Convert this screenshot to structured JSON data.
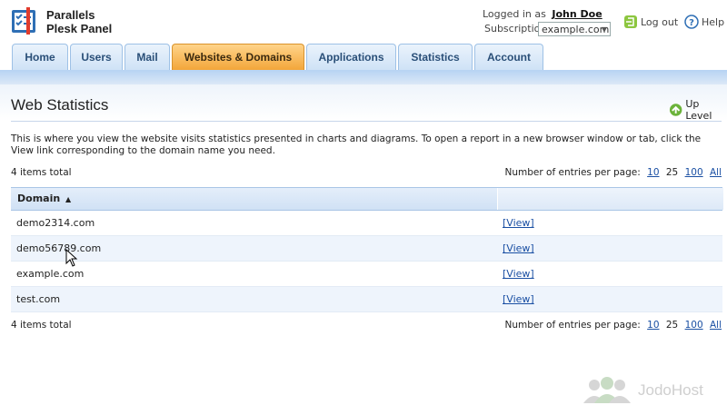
{
  "app": {
    "brand_line1": "Parallels",
    "brand_line2": "Plesk Panel"
  },
  "header": {
    "logged_in_label": "Logged in as",
    "user_name": "John Doe",
    "subscription_label": "Subscription",
    "subscription_value": "example.com",
    "logout_label": "Log out",
    "help_label": "Help"
  },
  "tabs": [
    {
      "label": "Home"
    },
    {
      "label": "Users"
    },
    {
      "label": "Mail"
    },
    {
      "label": "Websites & Domains"
    },
    {
      "label": "Applications"
    },
    {
      "label": "Statistics"
    },
    {
      "label": "Account"
    }
  ],
  "active_tab": "Websites & Domains",
  "page": {
    "title": "Web Statistics",
    "up_level": "Up Level",
    "description": "This is where you view the website visits statistics presented in charts and diagrams. To open a report in a new browser window or tab, click the View link corresponding to the domain name you need."
  },
  "list": {
    "items_total": "4 items total",
    "per_page_label": "Number of entries per page:",
    "per_page_options": [
      "10",
      "25",
      "100",
      "All"
    ],
    "per_page_current": "25",
    "column_domain": "Domain",
    "rows": [
      {
        "domain": "demo2314.com",
        "action": "[View]"
      },
      {
        "domain": "demo56789.com",
        "action": "[View]"
      },
      {
        "domain": "example.com",
        "action": "[View]"
      },
      {
        "domain": "test.com",
        "action": "[View]"
      }
    ]
  },
  "watermark": "JodoHost",
  "colors": {
    "active_tab": "#f3a63a",
    "tab": "#cfe2f6",
    "link": "#1a4fa3"
  }
}
